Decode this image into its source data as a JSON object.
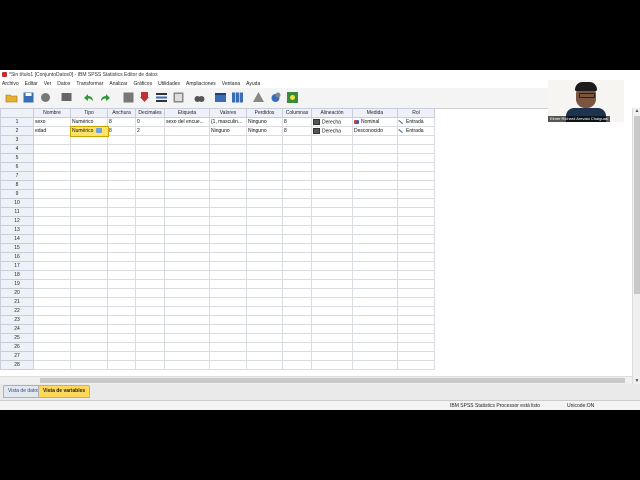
{
  "window": {
    "title": "*Sin título1 [ConjuntoDatos0] - IBM SPSS Statistics Editor de datos"
  },
  "menu": [
    "Archivo",
    "Editar",
    "Ver",
    "Datos",
    "Transformar",
    "Analizar",
    "Gráficos",
    "Utilidades",
    "Ampliaciones",
    "Ventana",
    "Ayuda"
  ],
  "columns": [
    "Nombre",
    "Tipo",
    "Anchura",
    "Decimales",
    "Etiqueta",
    "Valores",
    "Perdidos",
    "Columnas",
    "Alineación",
    "Medida",
    "Rol"
  ],
  "rows": [
    {
      "num": "1",
      "nombre": "sexo",
      "tipo": "Numérico",
      "anchura": "8",
      "decimales": "0",
      "etiqueta": "sexo del encue...",
      "valores": "{1, masculin...",
      "perdidos": "Ninguno",
      "columnas": "8",
      "alineacion": "Derecha",
      "medida": "Nominal",
      "rol": "Entrada"
    },
    {
      "num": "2",
      "nombre": "edad",
      "tipo": "Numérico",
      "anchura": "8",
      "decimales": "2",
      "etiqueta": "",
      "valores": "Ninguno",
      "perdidos": "Ninguno",
      "columnas": "8",
      "alineacion": "Derecha",
      "medida": "Desconocido",
      "rol": "Entrada"
    }
  ],
  "empty_rows": [
    "3",
    "4",
    "5",
    "6",
    "7",
    "8",
    "9",
    "10",
    "11",
    "12",
    "13",
    "14",
    "15",
    "16",
    "17",
    "18",
    "19",
    "20",
    "21",
    "22",
    "23",
    "24",
    "25",
    "26",
    "27",
    "28"
  ],
  "tabs": {
    "data_view": "Vista de datos",
    "variable_view": "Vista de variables"
  },
  "status": {
    "processor": "IBM SPSS Statistics Processor está listo",
    "encoding": "Unicode:ON"
  },
  "webcam": {
    "name": "Elmer Richard Arevalo Chaiguas"
  },
  "icons": [
    "open-icon",
    "save-icon",
    "print-icon",
    "dialog-recall-icon",
    "undo-icon",
    "redo-icon",
    "goto-case-icon",
    "goto-variable-icon",
    "variables-icon",
    "find-icon",
    "insert-cases-icon",
    "insert-variable-icon",
    "split-file-icon",
    "weight-cases-icon",
    "select-cases-icon",
    "value-labels-icon",
    "use-sets-icon"
  ],
  "colors": {
    "active_tab": "#ffd75a",
    "header_bg": "#eef2f8",
    "selected_cell": "#ffe26a"
  }
}
